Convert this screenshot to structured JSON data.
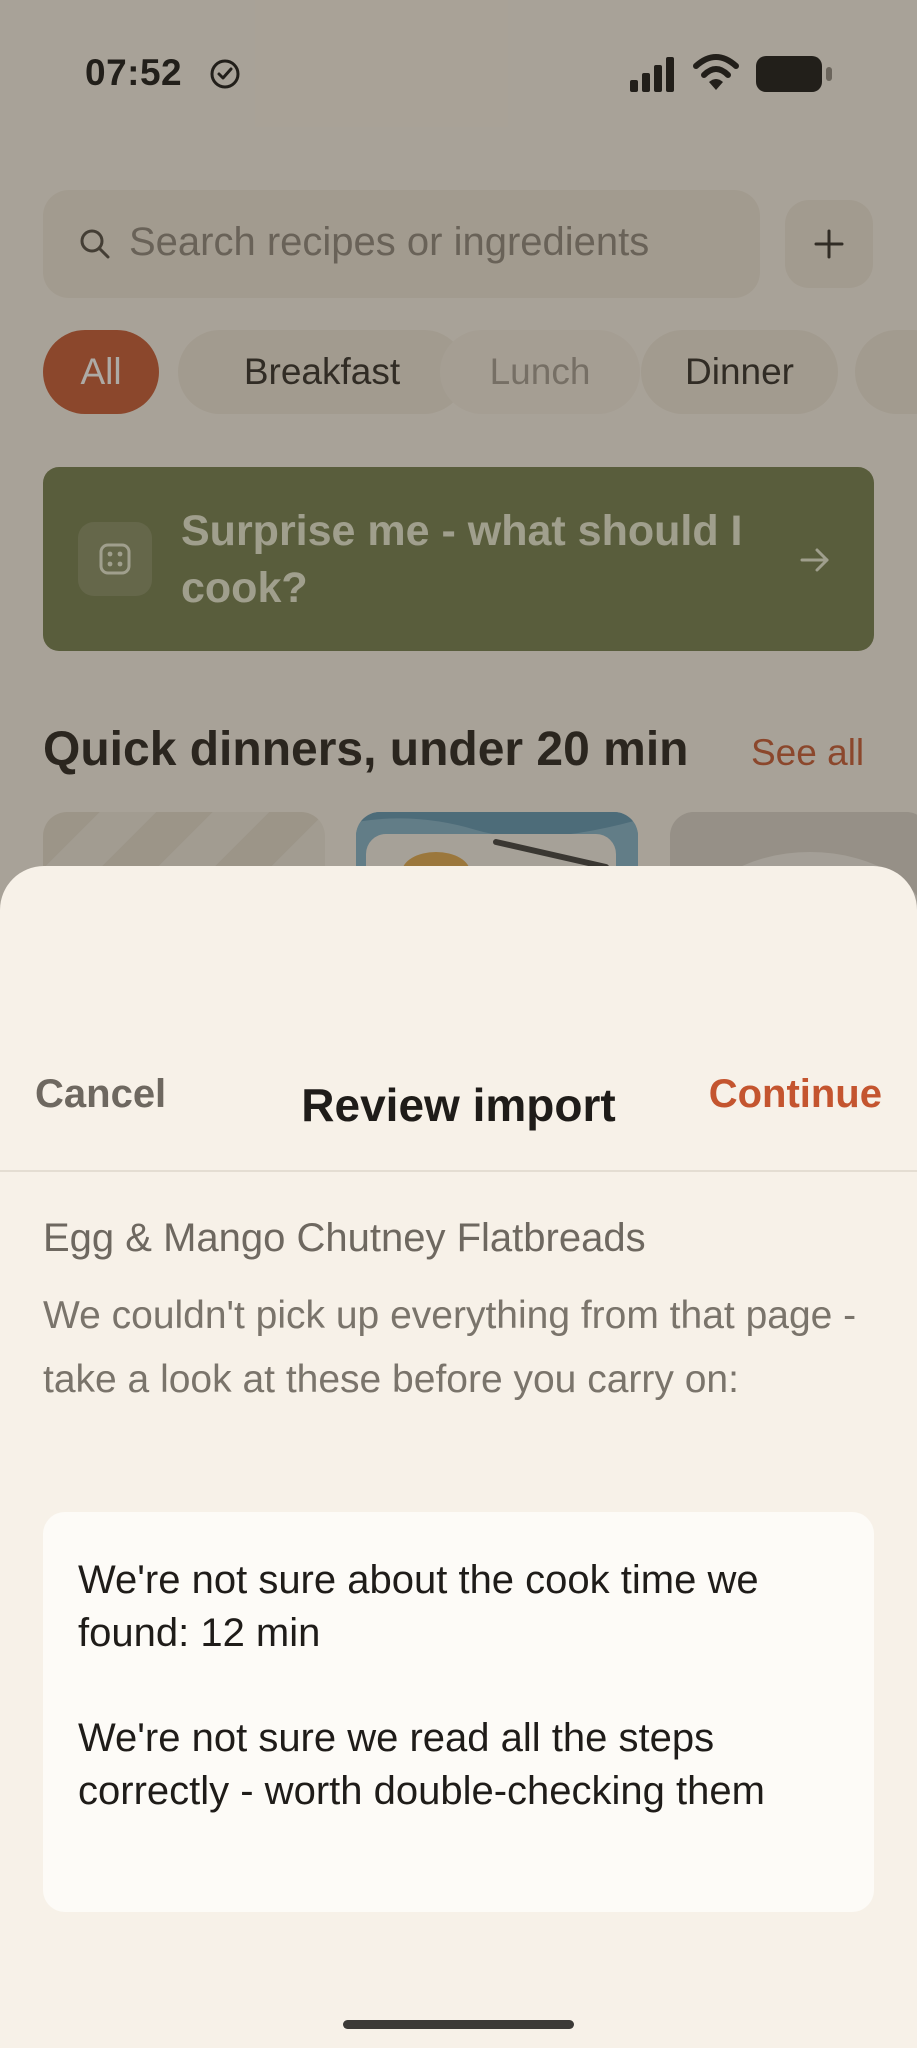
{
  "status_bar": {
    "time": "07:52",
    "icons": [
      "focus-check-icon",
      "signal-icon",
      "wifi-icon",
      "battery-icon"
    ]
  },
  "search": {
    "placeholder": "Search recipes or ingredients"
  },
  "filters": {
    "chips": [
      "All",
      "Breakfast",
      "Lunch",
      "Dinner"
    ],
    "selected": "All"
  },
  "surprise": {
    "label": "Surprise me - what should I cook?"
  },
  "section": {
    "title": "Quick dinners, under 20 min",
    "see_all": "See all"
  },
  "sheet": {
    "cancel": "Cancel",
    "title": "Review import",
    "continue": "Continue",
    "recipe_name": "Egg & Mango Chutney Flatbreads",
    "message": "We couldn't pick up everything from that page - take a look at these before you carry on:",
    "warnings": [
      "We're not sure about the cook time we found: 12 min",
      "We're not sure we read all the steps correctly - worth double-checking them"
    ]
  },
  "colors": {
    "accent": "#c4552f",
    "surprise_card": "#6f7a4a",
    "sheet_bg": "#f7f1e8"
  }
}
